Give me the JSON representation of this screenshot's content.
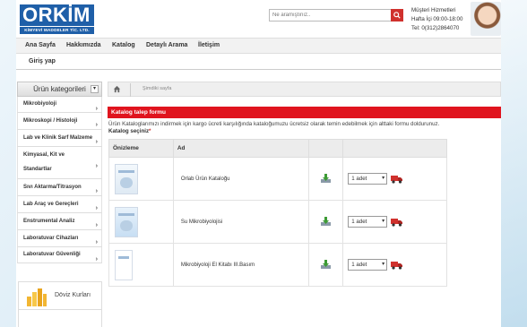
{
  "brand": {
    "name": "ORKİM",
    "tagline": "KİMYEVİ MADDELER TİC. LTD. ŞTİ."
  },
  "search": {
    "placeholder": "Ne aramıştınız.."
  },
  "service": {
    "title": "Müşteri Hizmetleri",
    "hours": "Hafta İçi 09:00-18:00",
    "phone": "Tel: 0(312)2864070"
  },
  "nav": {
    "items": [
      {
        "label": "Ana Sayfa"
      },
      {
        "label": "Hakkımızda"
      },
      {
        "label": "Katalog"
      },
      {
        "label": "Detaylı Arama"
      },
      {
        "label": "İletişim"
      }
    ],
    "login": "Giriş yap"
  },
  "sidebar": {
    "title": "Ürün kategorileri",
    "items": [
      {
        "label": "Mikrobiyoloji"
      },
      {
        "label": "Mikroskopi / Histoloji"
      },
      {
        "label": "Lab ve Klinik Sarf Malzeme"
      },
      {
        "label": "Kimyasal, Kit ve Standartlar"
      },
      {
        "label": "Sıvı Aktarma/Titrasyon"
      },
      {
        "label": "Lab Araç ve Gereçleri"
      },
      {
        "label": "Enstrumental Analiz"
      },
      {
        "label": "Laboratuvar Cihazları"
      },
      {
        "label": "Laboratuvar Güvenliği"
      }
    ],
    "doviz": "Döviz Kurları"
  },
  "breadcrumb": {
    "current": "Şimdiki sayfa"
  },
  "main": {
    "heading": "Katalog talep formu",
    "description": "Ürün Kataloglarımızı indirmek için kargo ücreti karşılığında kataloğumuzu ücretsiz olarak temin edebilmek için alttaki formu doldurunuz.",
    "select_label": "Katalog seçiniz",
    "required_mark": "*",
    "table": {
      "headers": [
        "Önizleme",
        "Ad",
        "",
        ""
      ],
      "rows": [
        {
          "name": "Orlab Ürün Kataloğu",
          "qty": "1 adet"
        },
        {
          "name": "Su Mikrobiyolojisi",
          "qty": "1 adet"
        },
        {
          "name": "Mikrobiyoloji El Kitabı III.Basım",
          "qty": "1 adet"
        }
      ]
    }
  },
  "colors": {
    "brand_blue": "#1f5fa8",
    "accent_red": "#e0141e"
  },
  "icons": {
    "home": "home-icon",
    "search": "search-icon",
    "download": "download-icon",
    "cart": "truck-icon"
  }
}
